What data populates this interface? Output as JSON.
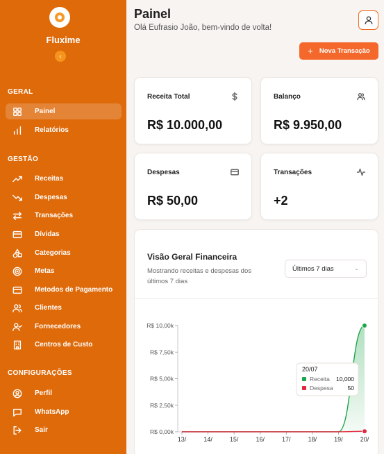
{
  "sidebar": {
    "brand": "Fluxime",
    "collapse_icon": "‹",
    "sections": [
      {
        "title": "GERAL"
      },
      {
        "title": "GESTÃO"
      },
      {
        "title": "CONFIGURAÇÕES"
      }
    ],
    "items": [
      {
        "label": "Painel",
        "icon": "grid-icon"
      },
      {
        "label": "Relatórios",
        "icon": "bar-chart-icon"
      },
      {
        "label": "Receitas",
        "icon": "trend-up-icon"
      },
      {
        "label": "Despesas",
        "icon": "trend-down-icon"
      },
      {
        "label": "Transações",
        "icon": "arrows-icon"
      },
      {
        "label": "Dívidas",
        "icon": "credit-card-icon"
      },
      {
        "label": "Categorias",
        "icon": "shapes-icon"
      },
      {
        "label": "Metas",
        "icon": "target-icon"
      },
      {
        "label": "Metodos de Pagamento",
        "icon": "card-icon"
      },
      {
        "label": "Clientes",
        "icon": "users-icon"
      },
      {
        "label": "Fornecedores",
        "icon": "user-check-icon"
      },
      {
        "label": "Centros de Custo",
        "icon": "building-icon"
      },
      {
        "label": "Perfil",
        "icon": "profile-icon"
      },
      {
        "label": "WhatsApp",
        "icon": "message-icon"
      },
      {
        "label": "Sair",
        "icon": "logout-icon"
      }
    ]
  },
  "header": {
    "title": "Painel",
    "subtitle": "Olá Eufrasio João, bem-vindo de volta!",
    "new_transaction": "Nova Transação",
    "plus": "+"
  },
  "stats": [
    {
      "label": "Receita Total",
      "value": "R$ 10.000,00",
      "icon": "dollar-icon"
    },
    {
      "label": "Balanço",
      "value": "R$ 9.950,00",
      "icon": "users-icon"
    },
    {
      "label": "Despesas",
      "value": "R$ 50,00",
      "icon": "credit-card-icon"
    },
    {
      "label": "Transações",
      "value": "+2",
      "icon": "activity-icon"
    }
  ],
  "overview": {
    "title": "Visão Geral Financeira",
    "description": "Mostrando receitas e despesas dos últimos 7 dias",
    "range": "Últimos 7 dias",
    "chevron": "⌄"
  },
  "chart_data": {
    "type": "area",
    "x": [
      "13/",
      "14/",
      "15/",
      "16/",
      "17/",
      "18/",
      "19/",
      "20/"
    ],
    "y_ticks": [
      "R$ 0,00k",
      "R$ 2,50k",
      "R$ 5,00k",
      "R$ 7,50k",
      "R$ 10,00k"
    ],
    "ylim": [
      0,
      10000
    ],
    "series": [
      {
        "name": "Receita",
        "color": "#1ea54a",
        "values": [
          0,
          0,
          0,
          0,
          0,
          0,
          0,
          10000
        ]
      },
      {
        "name": "Despesa",
        "color": "#e0283e",
        "values": [
          0,
          0,
          0,
          0,
          0,
          0,
          0,
          50
        ]
      }
    ],
    "tooltip": {
      "title": "20/07",
      "rows": [
        {
          "name": "Receita",
          "value": "10,000",
          "color": "#1ea54a"
        },
        {
          "name": "Despesa",
          "value": "50",
          "color": "#e0283e"
        }
      ]
    }
  }
}
